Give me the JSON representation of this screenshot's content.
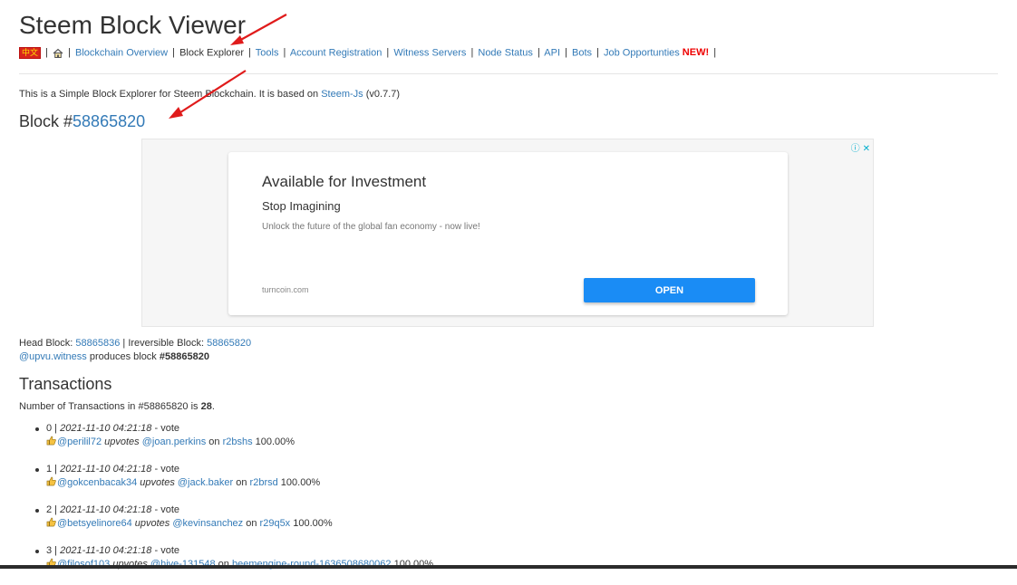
{
  "site": {
    "title": "Steem Block Viewer"
  },
  "nav": {
    "lang": "中文",
    "links": [
      "Blockchain Overview",
      "Block Explorer",
      "Tools",
      "Account Registration",
      "Witness Servers",
      "Node Status",
      "API",
      "Bots",
      "Job Opportunties"
    ],
    "new_badge": "NEW!"
  },
  "intro": {
    "text_before": "This is a Simple Block Explorer for Steem Blockchain. It is based on ",
    "link": "Steem-Js",
    "text_after": " (v0.7.7)"
  },
  "block": {
    "prefix": "Block #",
    "number": "58865820"
  },
  "ad": {
    "title": "Available for Investment",
    "subtitle": "Stop Imagining",
    "description": "Unlock the future of the global fan economy - now live!",
    "domain": "turncoin.com",
    "button": "OPEN",
    "info_glyph": "ⓘ",
    "close_glyph": "✕"
  },
  "head": {
    "head_label": "Head Block: ",
    "head_value": "58865836",
    "sep": " | ",
    "irr_label": "Ireversible Block: ",
    "irr_value": "58865820",
    "witness": "@upvu.witness",
    "produces": " produces block ",
    "produced_block": "#58865820"
  },
  "transactions": {
    "heading": "Transactions",
    "count_prefix": "Number of Transactions in ",
    "count_block": "#58865820",
    "count_mid": " is ",
    "count_value": "28",
    "count_suffix": ".",
    "items": [
      {
        "index": "0 | ",
        "date": "2021-11-10 04:21:18",
        "type": " - vote",
        "voter": "@perilil72",
        "verb": " upvotes ",
        "author": "@joan.perkins",
        "on": " on ",
        "permlink": "r2bshs",
        "weight": " 100.00%"
      },
      {
        "index": "1 | ",
        "date": "2021-11-10 04:21:18",
        "type": " - vote",
        "voter": "@gokcenbacak34",
        "verb": " upvotes ",
        "author": "@jack.baker",
        "on": " on ",
        "permlink": "r2brsd",
        "weight": " 100.00%"
      },
      {
        "index": "2 | ",
        "date": "2021-11-10 04:21:18",
        "type": " - vote",
        "voter": "@betsyelinore64",
        "verb": " upvotes ",
        "author": "@kevinsanchez",
        "on": " on ",
        "permlink": "r29q5x",
        "weight": " 100.00%"
      },
      {
        "index": "3 | ",
        "date": "2021-11-10 04:21:18",
        "type": " - vote",
        "voter": "@filosof103",
        "verb": " upvotes ",
        "author": "@hive-131548",
        "on": " on ",
        "permlink": "beemengine-round-1636508680062",
        "weight": " 100.00%"
      }
    ]
  },
  "colors": {
    "link": "#337ab7",
    "new_badge": "#ee0000",
    "open_button": "#1a8cf5",
    "arrow": "#e01b1b"
  }
}
